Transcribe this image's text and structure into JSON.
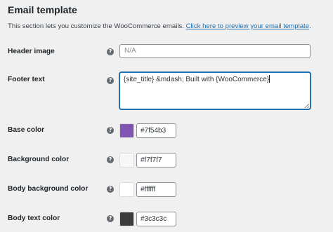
{
  "section": {
    "title": "Email template",
    "description": "This section lets you customize the WooCommerce emails.",
    "preview_link": "Click here to preview your email template",
    "description_end": "."
  },
  "help_glyph": "?",
  "header_image": {
    "label": "Header image",
    "value": "N/A"
  },
  "footer_text": {
    "label": "Footer text",
    "value": "{site_title} &mdash; Built with {WooCommerce}"
  },
  "colors": [
    {
      "label": "Base color",
      "value": "#7f54b3",
      "swatch": "#7f54b3"
    },
    {
      "label": "Background color",
      "value": "#f7f7f7",
      "swatch": "#f7f7f7"
    },
    {
      "label": "Body background color",
      "value": "#ffffff",
      "swatch": "#ffffff"
    },
    {
      "label": "Body text color",
      "value": "#3c3c3c",
      "swatch": "#3c3c3c"
    }
  ]
}
